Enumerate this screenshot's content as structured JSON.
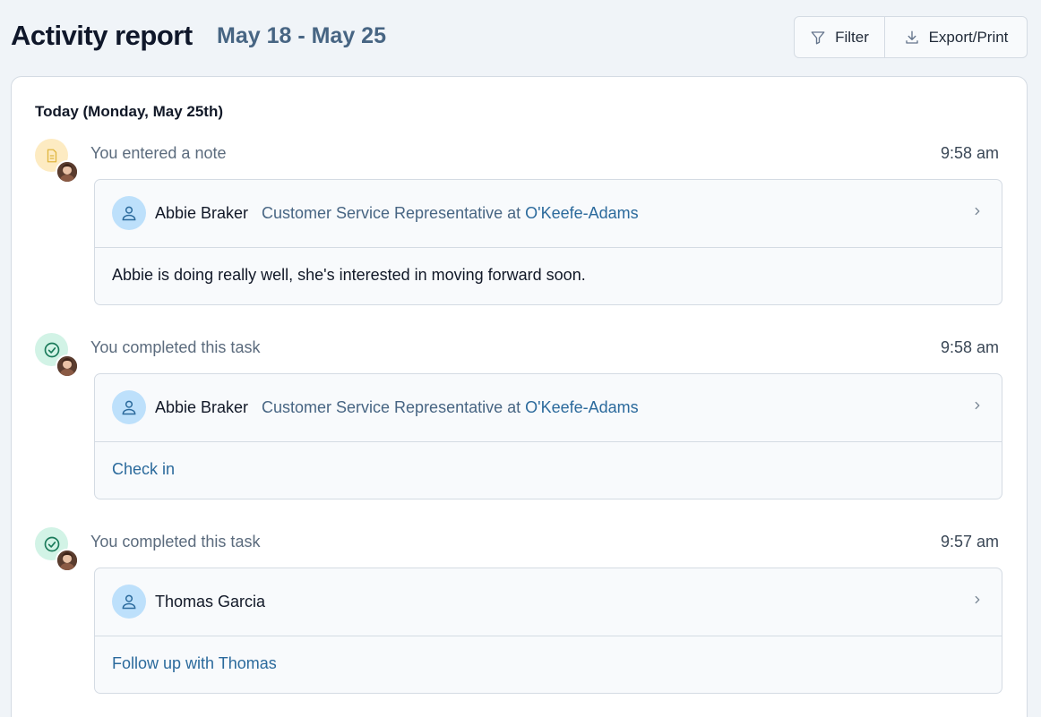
{
  "header": {
    "title": "Activity report",
    "date_range": "May 18 - May 25",
    "filter_label": "Filter",
    "export_label": "Export/Print"
  },
  "feed": {
    "day_heading": "Today (Monday, May 25th)",
    "entries": [
      {
        "icon": "note-icon",
        "title": "You entered a note",
        "time": "9:58 am",
        "contact_name": "Abbie Braker",
        "contact_role": "Customer Service Representative at",
        "company": "O'Keefe-Adams",
        "body": "Abbie is doing really well, she's interested in moving forward soon."
      },
      {
        "icon": "check-circle-icon",
        "title": "You completed this task",
        "time": "9:58 am",
        "contact_name": "Abbie Braker",
        "contact_role": "Customer Service Representative at",
        "company": "O'Keefe-Adams",
        "body": "Check in"
      },
      {
        "icon": "check-circle-icon",
        "title": "You completed this task",
        "time": "9:57 am",
        "contact_name": "Thomas Garcia",
        "contact_role": "",
        "company": "",
        "body": "Follow up with Thomas"
      }
    ]
  },
  "colors": {
    "page_bg": "#f0f4f8",
    "accent_link": "#2b6a9c",
    "note_badge": "#fdebc2",
    "task_badge": "#d2f3e6",
    "person_badge": "#bde0fb"
  }
}
